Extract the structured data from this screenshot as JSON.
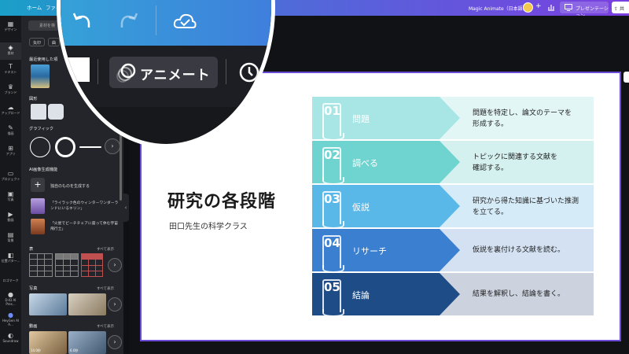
{
  "topbar": {
    "menu": [
      "ホーム",
      "ファイル"
    ],
    "doc_title": "Magic Animate（日本語）",
    "present_label": "プレゼンテーション",
    "share_label": "共",
    "plus": "+"
  },
  "rail": [
    {
      "label": "デザイン",
      "glyph": "▦"
    },
    {
      "label": "素材",
      "glyph": "◈"
    },
    {
      "label": "テキスト",
      "glyph": "T"
    },
    {
      "label": "ブランド",
      "glyph": "♛"
    },
    {
      "label": "アップロード",
      "glyph": "☁"
    },
    {
      "label": "描画",
      "glyph": "✎"
    },
    {
      "label": "アプリ",
      "glyph": "⊞"
    },
    {
      "label": "プロジェクト",
      "glyph": "▭"
    },
    {
      "label": "写真",
      "glyph": "▣"
    },
    {
      "label": "動画",
      "glyph": "▶"
    },
    {
      "label": "背景",
      "glyph": "▤"
    },
    {
      "label": "位置パター...",
      "glyph": "◧"
    },
    {
      "label": "ロゴマーク",
      "glyph": ""
    },
    {
      "label": "D-ID AI Pres...",
      "glyph": "●"
    },
    {
      "label": "HeyGen AI A...",
      "glyph": "●"
    },
    {
      "label": "Soundraw",
      "glyph": "◐"
    }
  ],
  "panel": {
    "search_placeholder": "素材を検",
    "chips": [
      "矢印",
      "曲"
    ],
    "recent_label": "最近使用した項",
    "shapes_label": "図形",
    "graphics_label": "グラフィック",
    "ai_label": "AI画像生成機能",
    "generate_label": "独自のものを生成する",
    "ai_items": [
      "「ライラック色のウィンターワンダーランドにいるキリン」",
      "「火星でビーチチェアに座って休む宇宙飛行士」"
    ],
    "tables_label": "表",
    "photos_label": "写真",
    "videos_label": "動画",
    "see_all": "すべて表示",
    "video_durations": [
      "14.0秒",
      "6.0秒"
    ]
  },
  "lens": {
    "animate_label": "アニメート"
  },
  "slide": {
    "title": "研究の各段階",
    "subtitle": "田口先生の科学クラス",
    "steps": [
      {
        "num": "01",
        "label": "問題",
        "desc_lines": [
          "問題を特定し、論文のテーマを",
          "形成する。"
        ],
        "arrow_color": "#a7e6e4",
        "bg_color": "#e2f6f6"
      },
      {
        "num": "02",
        "label": "調べる",
        "desc_lines": [
          "トピックに関連する文献を",
          "確認する。"
        ],
        "arrow_color": "#6fd3d0",
        "bg_color": "#d4f0ef"
      },
      {
        "num": "03",
        "label": "仮説",
        "desc_lines": [
          "研究から得た知識に基づいた推測",
          "を立てる。"
        ],
        "arrow_color": "#5ab8e8",
        "bg_color": "#d5ebf8"
      },
      {
        "num": "04",
        "label": "リサーチ",
        "desc_lines": [
          "仮説を裏付ける文献を読む。"
        ],
        "arrow_color": "#3a7fd0",
        "bg_color": "#d3e1f3"
      },
      {
        "num": "05",
        "label": "結論",
        "desc_lines": [
          "結果を解釈し、結論を書く。"
        ],
        "arrow_color": "#1e4c86",
        "bg_color": "#ccd3de"
      }
    ]
  }
}
